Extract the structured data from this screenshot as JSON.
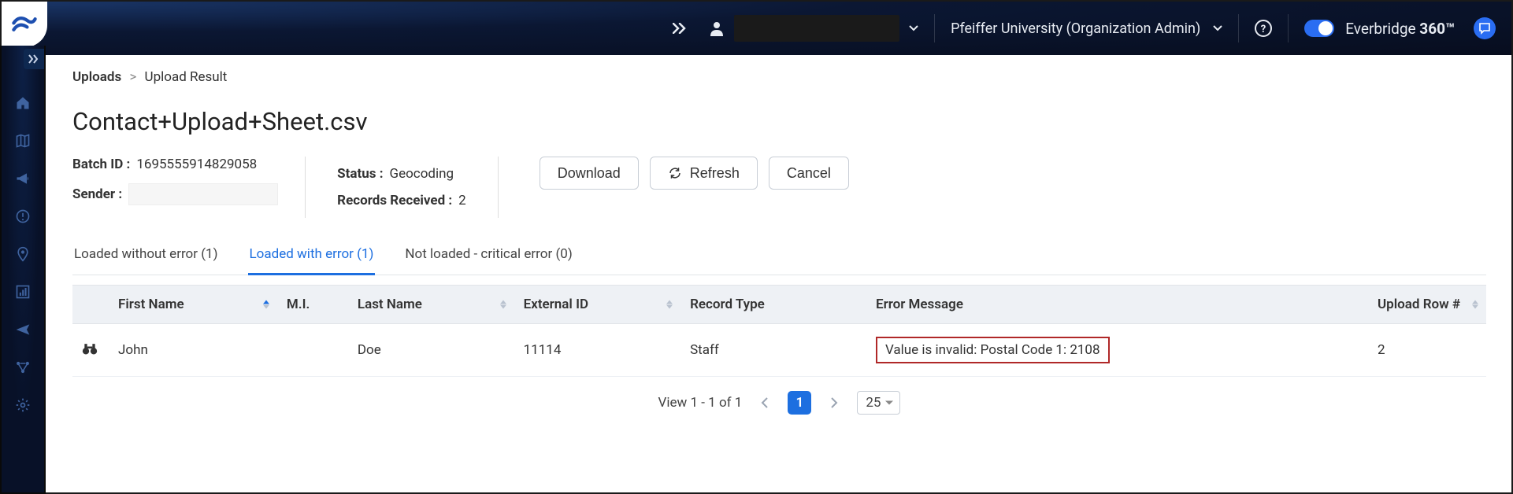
{
  "header": {
    "org_label": "Pfeiffer University (Organization Admin)",
    "brand_a": "Everbridge",
    "brand_b": "360™"
  },
  "breadcrumb": {
    "root": "Uploads",
    "current": "Upload Result"
  },
  "page": {
    "title": "Contact+Upload+Sheet.csv"
  },
  "meta": {
    "batch_id_label": "Batch ID :",
    "batch_id": "1695555914829058",
    "sender_label": "Sender :",
    "status_label": "Status :",
    "status": "Geocoding",
    "records_label": "Records Received :",
    "records": "2"
  },
  "buttons": {
    "download": "Download",
    "refresh": "Refresh",
    "cancel": "Cancel"
  },
  "tabs": [
    {
      "label": "Loaded without error (1)",
      "active": false
    },
    {
      "label": "Loaded with error (1)",
      "active": true
    },
    {
      "label": "Not loaded - critical error (0)",
      "active": false
    }
  ],
  "table": {
    "columns": {
      "first_name": "First Name",
      "mi": "M.I.",
      "last_name": "Last Name",
      "external_id": "External ID",
      "record_type": "Record Type",
      "error_message": "Error Message",
      "upload_row": "Upload Row #"
    },
    "rows": [
      {
        "first_name": "John",
        "mi": "",
        "last_name": "Doe",
        "external_id": "11114",
        "record_type": "Staff",
        "error_message": "Value is invalid: Postal Code 1: 2108",
        "upload_row": "2"
      }
    ]
  },
  "pagination": {
    "summary": "View 1 - 1 of 1",
    "current": "1",
    "page_size": "25"
  }
}
